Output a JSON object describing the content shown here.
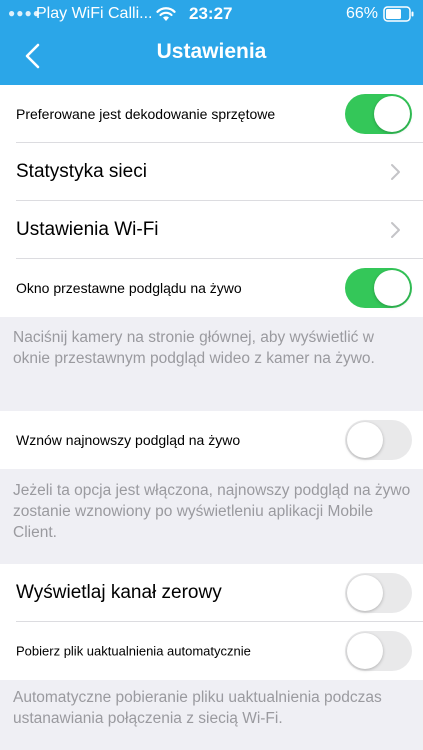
{
  "status_bar": {
    "carrier": "Play WiFi Calli...",
    "time": "23:27",
    "battery": "66%"
  },
  "nav": {
    "title": "Ustawienia",
    "back_icon": "chevron-left-icon"
  },
  "settings": {
    "hardware_decoding": {
      "label": "Preferowane jest dekodowanie sprzętowe",
      "enabled": true
    },
    "network_stats": {
      "label": "Statystyka sieci"
    },
    "wifi_settings": {
      "label": "Ustawienia Wi-Fi"
    },
    "floating_window": {
      "label": "Okno przestawne podglądu na żywo",
      "enabled": true,
      "note": "Naciśnij kamery na stronie głównej, aby wyświetlić w oknie przestawnym podgląd wideo z kamer na żywo."
    },
    "resume_live": {
      "label": "Wznów najnowszy podgląd na żywo",
      "enabled": false,
      "note": "Jeżeli ta opcja jest włączona, najnowszy podgląd na żywo zostanie wznowiony po wyświetleniu aplikacji Mobile Client."
    },
    "zero_channel": {
      "label": "Wyświetlaj kanał zerowy",
      "enabled": false
    },
    "auto_download": {
      "label": "Pobierz plik uaktualnienia automatycznie",
      "enabled": false,
      "note": "Automatyczne pobieranie pliku uaktualnienia podczas ustanawiania połączenia z siecią Wi-Fi."
    }
  },
  "colors": {
    "header": "#2ba6e8",
    "toggle_on": "#34c759",
    "toggle_off": "#e9e9ea",
    "note_text": "#9a9a9f",
    "background": "#efeff4"
  }
}
